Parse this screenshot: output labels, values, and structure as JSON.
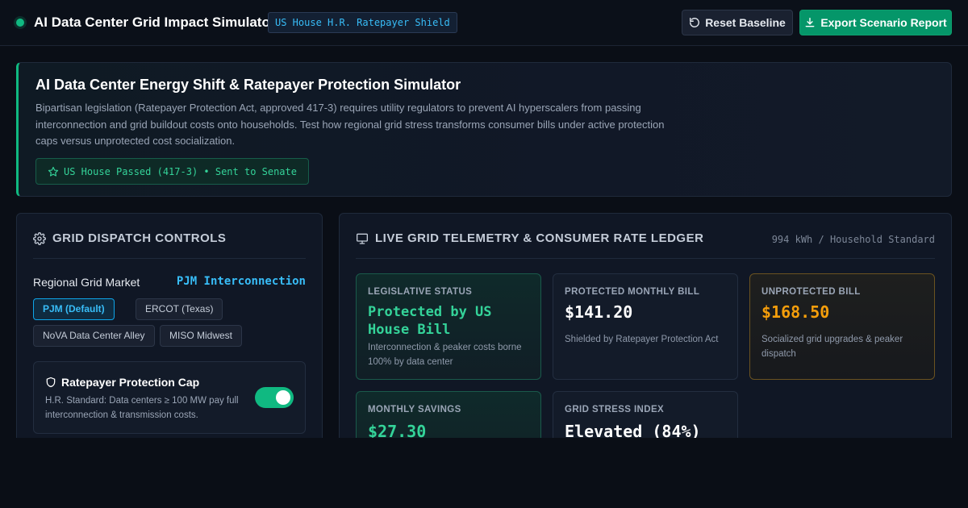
{
  "header": {
    "app_title": "AI Data Center Grid Impact Simulator",
    "bill_chip": "US House H.R. Ratepayer Shield",
    "reset_label": "Reset Baseline",
    "export_label": "Export Scenario Report",
    "reset_icon": "rotate-ccw-icon",
    "export_icon": "download-icon"
  },
  "hero": {
    "title": "AI Data Center Energy Shift & Ratepayer Protection Simulator",
    "description": "Bipartisan legislation (Ratepayer Protection Act, approved 417-3) requires utility regulators to prevent AI hyperscalers from passing interconnection and grid buildout costs onto households. Test how regional grid stress transforms consumer bills under active protection caps versus unprotected cost socialization.",
    "badge": "US House Passed (417-3) • Sent to Senate",
    "badge_icon": "star-icon"
  },
  "controls": {
    "heading": "GRID DISPATCH CONTROLS",
    "heading_icon": "gear-icon",
    "market_label": "Regional Grid Market",
    "market_value": "PJM Interconnection",
    "markets": [
      "PJM (Default)",
      "ERCOT (Texas)",
      "NoVA Data Center Alley",
      "MISO Midwest"
    ],
    "selected_market": "PJM (Default)",
    "protection": {
      "title": "Ratepayer Protection Cap",
      "icon": "shield-icon",
      "description": "H.R. Standard: Data centers ≥ 100 MW pay full interconnection & transmission costs.",
      "enabled": true
    }
  },
  "telemetry": {
    "heading": "LIVE GRID TELEMETRY & CONSUMER RATE LEDGER",
    "heading_icon": "monitor-icon",
    "unit": "994 kWh / Household Standard",
    "cards": [
      {
        "label": "LEGISLATIVE STATUS",
        "value": "Protected by US House Bill",
        "note": "Interconnection & peaker costs borne 100% by data center"
      },
      {
        "label": "PROTECTED MONTHLY BILL",
        "value": "$141.20",
        "note": "Shielded by Ratepayer Protection Act"
      },
      {
        "label": "UNPROTECTED BILL",
        "value": "$168.50",
        "note": "Socialized grid upgrades & peaker dispatch"
      },
      {
        "label": "MONTHLY SAVINGS",
        "value": "$27.30"
      },
      {
        "label": "GRID STRESS INDEX",
        "value": "Elevated (84%)"
      }
    ]
  },
  "colors": {
    "accent_green": "#10b981",
    "accent_blue": "#38bdf8",
    "accent_amber": "#f59e0b",
    "background": "#0a0e16"
  }
}
